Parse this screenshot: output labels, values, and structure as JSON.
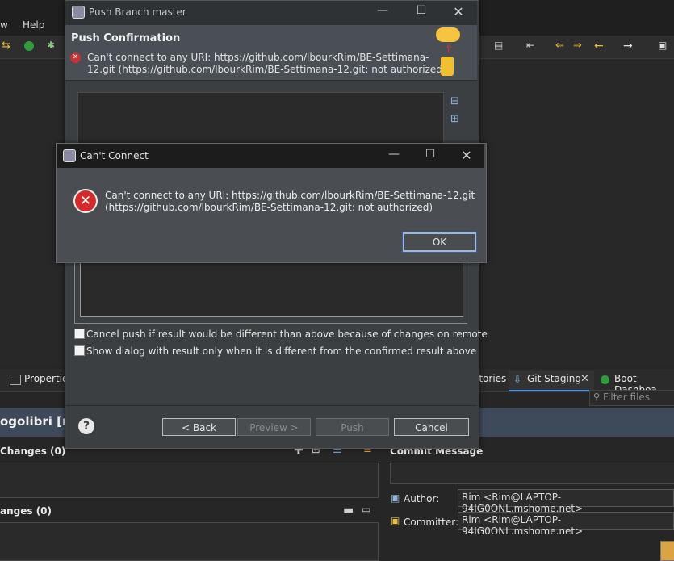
{
  "ide": {
    "menu_partial_left": "w",
    "menu_help": "Help",
    "view_tabs": {
      "properties": "Properties",
      "repositories_partial": "itories",
      "git_staging": "Git Staging",
      "boot_dashboard": "Boot Dashboa"
    },
    "filter_placeholder": "Filter files",
    "staging_title_partial": "ogolibri [m",
    "unstaged_label": "Changes (0)",
    "staged_label": "anges (0)",
    "commit_message_label": "Commit Message",
    "author_label": "Author:",
    "author_value": "Rim <Rim@LAPTOP-94IG0ONL.mshome.net>",
    "committer_label": "Committer:",
    "committer_value": "Rim <Rim@LAPTOP-94IG0ONL.mshome.net>"
  },
  "push_dialog": {
    "window_title": "Push Branch master",
    "heading": "Push Confirmation",
    "error_line1": "Can't connect to any URI: https://github.com/lbourkRim/BE-Settimana-",
    "error_line2": "12.git (https://github.com/lbourkRim/BE-Settimana-12.git: not authorized)",
    "checkbox1": "Cancel push if result would be different than above because of changes on remote",
    "checkbox2": "Show dialog with result only when it is different from the confirmed result above",
    "back_button": "< Back",
    "preview_button": "Preview >",
    "push_button": "Push",
    "cancel_button": "Cancel"
  },
  "error_dialog": {
    "window_title": "Can't Connect",
    "message_line1": "Can't connect to any URI: https://github.com/lbourkRim/BE-Settimana-12.git",
    "message_line2": "(https://github.com/lbourkRim/BE-Settimana-12.git: not authorized)",
    "ok_button": "OK"
  }
}
